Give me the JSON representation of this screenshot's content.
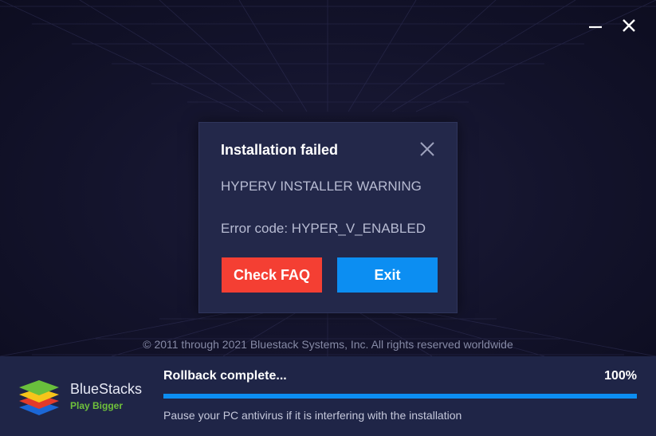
{
  "window": {
    "minimize_icon": "minimize-icon",
    "close_icon": "close-icon"
  },
  "dialog": {
    "title": "Installation failed",
    "message": "HYPERV INSTALLER WARNING",
    "error": "Error code: HYPER_V_ENABLED",
    "close_icon": "close-icon",
    "check_faq_label": "Check FAQ",
    "exit_label": "Exit",
    "check_faq_color": "#f43f33",
    "exit_color": "#0c8ef2"
  },
  "copyright": "© 2011 through 2021 Bluestack Systems, Inc. All rights reserved worldwide",
  "footer": {
    "brand_name": "BlueStacks",
    "brand_tagline": "Play Bigger",
    "logo_icon": "bluestacks-logo",
    "status": "Rollback complete...",
    "percent_label": "100%",
    "progress": 1.0,
    "hint": "Pause your PC antivirus if it is interfering with the installation"
  },
  "colors": {
    "background": "#12122a",
    "dialog_bg": "#23284a",
    "footer_bg": "#1f2547",
    "accent_blue": "#0c8ef2",
    "accent_red": "#f43f33",
    "brand_green": "#6fc13b"
  }
}
